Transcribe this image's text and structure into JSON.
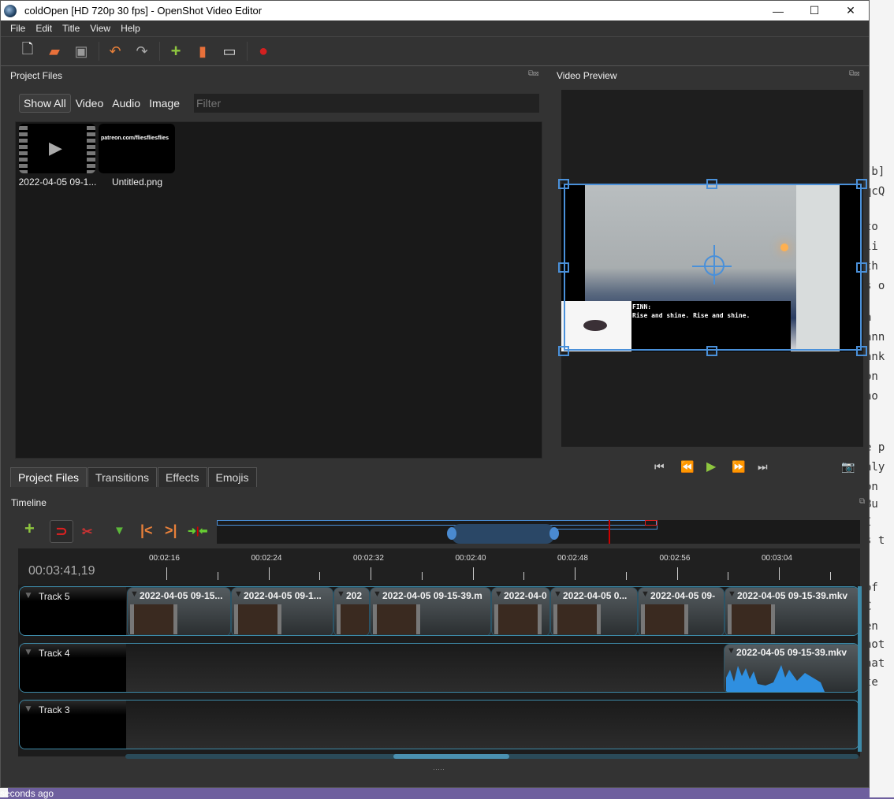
{
  "window": {
    "title": "coldOpen [HD 720p 30 fps] - OpenShot Video Editor",
    "minimize": "—",
    "maximize": "☐",
    "close": "✕"
  },
  "menu": [
    "File",
    "Edit",
    "Title",
    "View",
    "Help"
  ],
  "toolbar": {
    "icons": [
      "new-project-icon",
      "open-project-icon",
      "save-project-icon",
      "undo-icon",
      "redo-icon",
      "import-files-icon",
      "profile-icon",
      "fullscreen-icon",
      "export-video-icon"
    ]
  },
  "project_files": {
    "title": "Project Files",
    "filters": [
      "Show All",
      "Video",
      "Audio",
      "Image"
    ],
    "filter_placeholder": "Filter",
    "files": [
      {
        "name": "2022-04-05 09-1...",
        "type": "video"
      },
      {
        "name": "Untitled.png",
        "type": "image",
        "thumb_text": "patreon.com/fliesfliesflies"
      }
    ]
  },
  "bottom_tabs": [
    "Project Files",
    "Transitions",
    "Effects",
    "Emojis"
  ],
  "video_preview": {
    "title": "Video Preview",
    "caption_speaker": "FINN:",
    "caption_line": "Rise and shine. Rise and shine.",
    "controls": [
      "⏮",
      "⏪",
      "▶",
      "⏩",
      "⏭"
    ],
    "camera": "📷"
  },
  "timeline": {
    "title": "Timeline",
    "current_time": "00:03:41,19",
    "ticks": [
      "00:02:16",
      "00:02:24",
      "00:02:32",
      "00:02:40",
      "00:02:48",
      "00:02:56",
      "00:03:04"
    ],
    "tracks": [
      {
        "name": "Track 5",
        "clips": [
          "2022-04-05 09-15...",
          "2022-04-05 09-1...",
          "202",
          "2022-04-05 09-15-39.m",
          "2022-04-0",
          "2022-04-05 0...",
          "2022-04-05 09-",
          "2022-04-05 09-15-39.mkv"
        ]
      },
      {
        "name": "Track 4",
        "clips": [
          "2022-04-05 09-15-39.mkv"
        ]
      },
      {
        "name": "Track 3",
        "clips": []
      }
    ]
  },
  "status": "seconds ago",
  "background_text": [
    "[b]",
    "qcQ",
    "to",
    "li",
    "th",
    "s o",
    "a",
    "ann",
    "ank",
    "on",
    "no",
    "e p",
    "nly",
    "on",
    "Bu",
    "I",
    "s t",
    "of",
    "C",
    "en",
    "hot",
    "hat",
    "te"
  ],
  "colors": {
    "accent": "#4a90d9",
    "track_border": "#3d8aa8",
    "play": "#8ec63f",
    "record": "#d32020"
  }
}
